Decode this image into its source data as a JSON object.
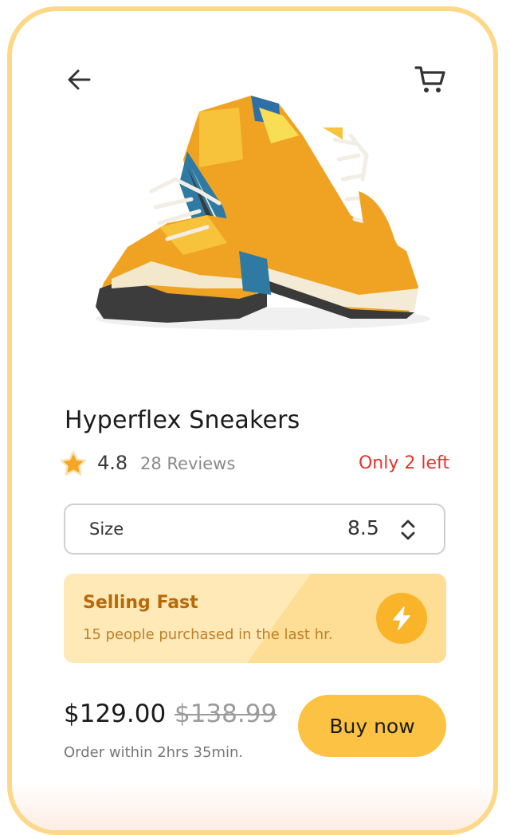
{
  "product": {
    "name": "Hyperflex Sneakers",
    "rating": "4.8",
    "reviews": "28 Reviews",
    "stock": "Only 2 left",
    "image_icon": "sneakers-image"
  },
  "size": {
    "label": "Size",
    "value": "8.5"
  },
  "promo": {
    "title": "Selling Fast",
    "subtitle": "15 people purchased in the last hr.",
    "icon": "lightning-icon"
  },
  "pricing": {
    "price": "$129.00",
    "old_price": "$138.99",
    "deadline": "Order within 2hrs 35min."
  },
  "actions": {
    "buy_label": "Buy now",
    "back_icon": "arrow-left-icon",
    "cart_icon": "cart-icon"
  },
  "colors": {
    "frame": "#FDD889",
    "accent": "#FCC243",
    "alert": "#E8332B",
    "promo_text": "#B86A0A",
    "star": "#F6A623"
  }
}
